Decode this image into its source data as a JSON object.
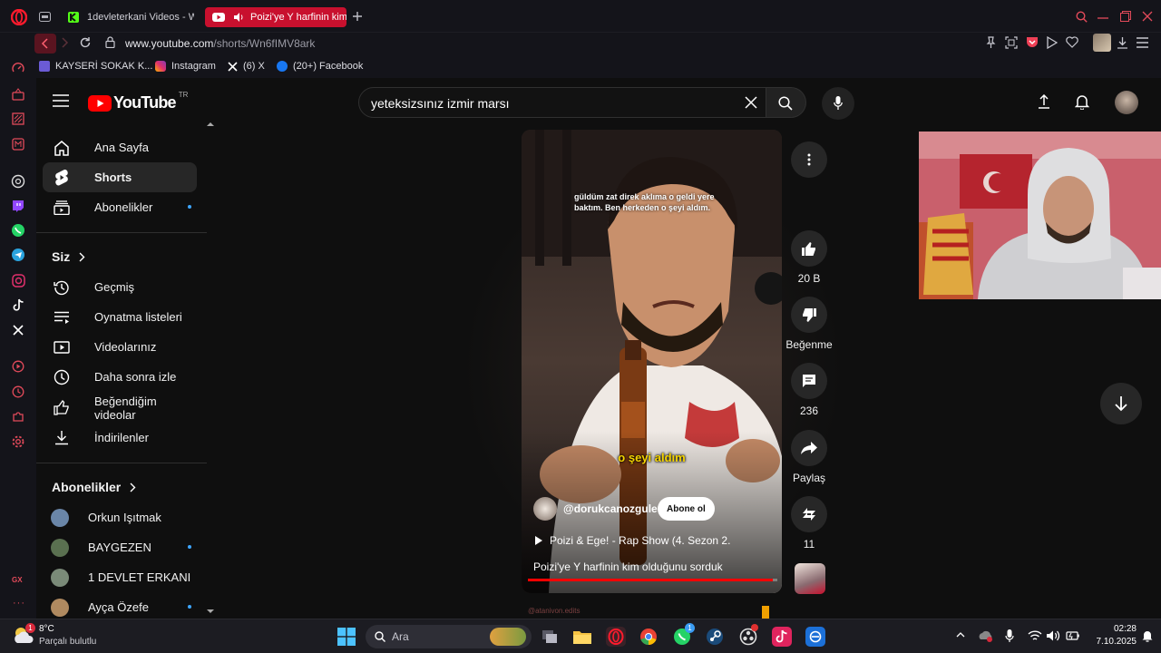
{
  "browser": {
    "tabs": [
      {
        "title": "1devleterkani Videos - Wa",
        "active": false
      },
      {
        "title": "Poizi'ye Y harfinin kim",
        "active": true
      }
    ],
    "url_domain": "www.youtube.com",
    "url_path": "/shorts/Wn6fIMV8ark",
    "bookmarks": [
      {
        "label": "KAYSERİ SOKAK K..."
      },
      {
        "label": "Instagram"
      },
      {
        "label": "(6) X"
      },
      {
        "label": "(20+) Facebook"
      }
    ],
    "sidebar_badge": "GX"
  },
  "youtube": {
    "logo_text": "YouTube",
    "region": "TR",
    "search_query": "yeteksizsınız  izmir marsı",
    "nav_main": [
      {
        "label": "Ana Sayfa",
        "icon": "home-icon"
      },
      {
        "label": "Shorts",
        "icon": "shorts-icon",
        "active": true
      },
      {
        "label": "Abonelikler",
        "icon": "subscriptions-icon"
      }
    ],
    "you_section": "Siz",
    "nav_you": [
      {
        "label": "Geçmiş",
        "icon": "history-icon"
      },
      {
        "label": "Oynatma listeleri",
        "icon": "playlists-icon"
      },
      {
        "label": "Videolarınız",
        "icon": "your-videos-icon"
      },
      {
        "label": "Daha sonra izle",
        "icon": "watch-later-icon"
      },
      {
        "label": "Beğendiğim videolar",
        "icon": "liked-icon"
      },
      {
        "label": "İndirilenler",
        "icon": "downloads-icon"
      }
    ],
    "subs_section": "Abonelikler",
    "subscriptions": [
      {
        "name": "Orkun Işıtmak",
        "new": false,
        "color": "#6a86a8"
      },
      {
        "name": "BAYGEZEN",
        "new": true,
        "color": "#5a7050"
      },
      {
        "name": "1 DEVLET ERKANI",
        "new": false,
        "color": "#7a8a78"
      },
      {
        "name": "Ayça Özefe",
        "new": true,
        "color": "#b08a60"
      }
    ]
  },
  "short": {
    "top_caption": "güldüm zat direk aklıma o geldi yere baktım. Ben herkeden o şeyi aldım.",
    "subtitle": "o şeyi aldım",
    "channel": "@dorukcanozguler",
    "subscribe": "Abone ol",
    "music": "Poizi & Ege! - Rap Show (4. Sezon 2.",
    "title": "Poizi'ye Y harfinin kim olduğunu sorduk",
    "watermark": "@atanivon.edits",
    "progress": 0.98
  },
  "actions": {
    "likes": "20 B",
    "dislike": "Beğenme",
    "comments": "236",
    "share": "Paylaş",
    "remix": "11"
  },
  "taskbar": {
    "weather_temp": "8°C",
    "weather_desc": "Parçalı bulutlu",
    "weather_badge": "1",
    "search_placeholder": "Ara",
    "whatsapp_badge": "1",
    "time": "02:28",
    "date": "7.10.2025"
  },
  "colors": {
    "opera_red": "#c8102e",
    "yt_red": "#ff0000",
    "subtitle_yellow": "#f5d400",
    "link_blue": "#3ea6ff"
  }
}
